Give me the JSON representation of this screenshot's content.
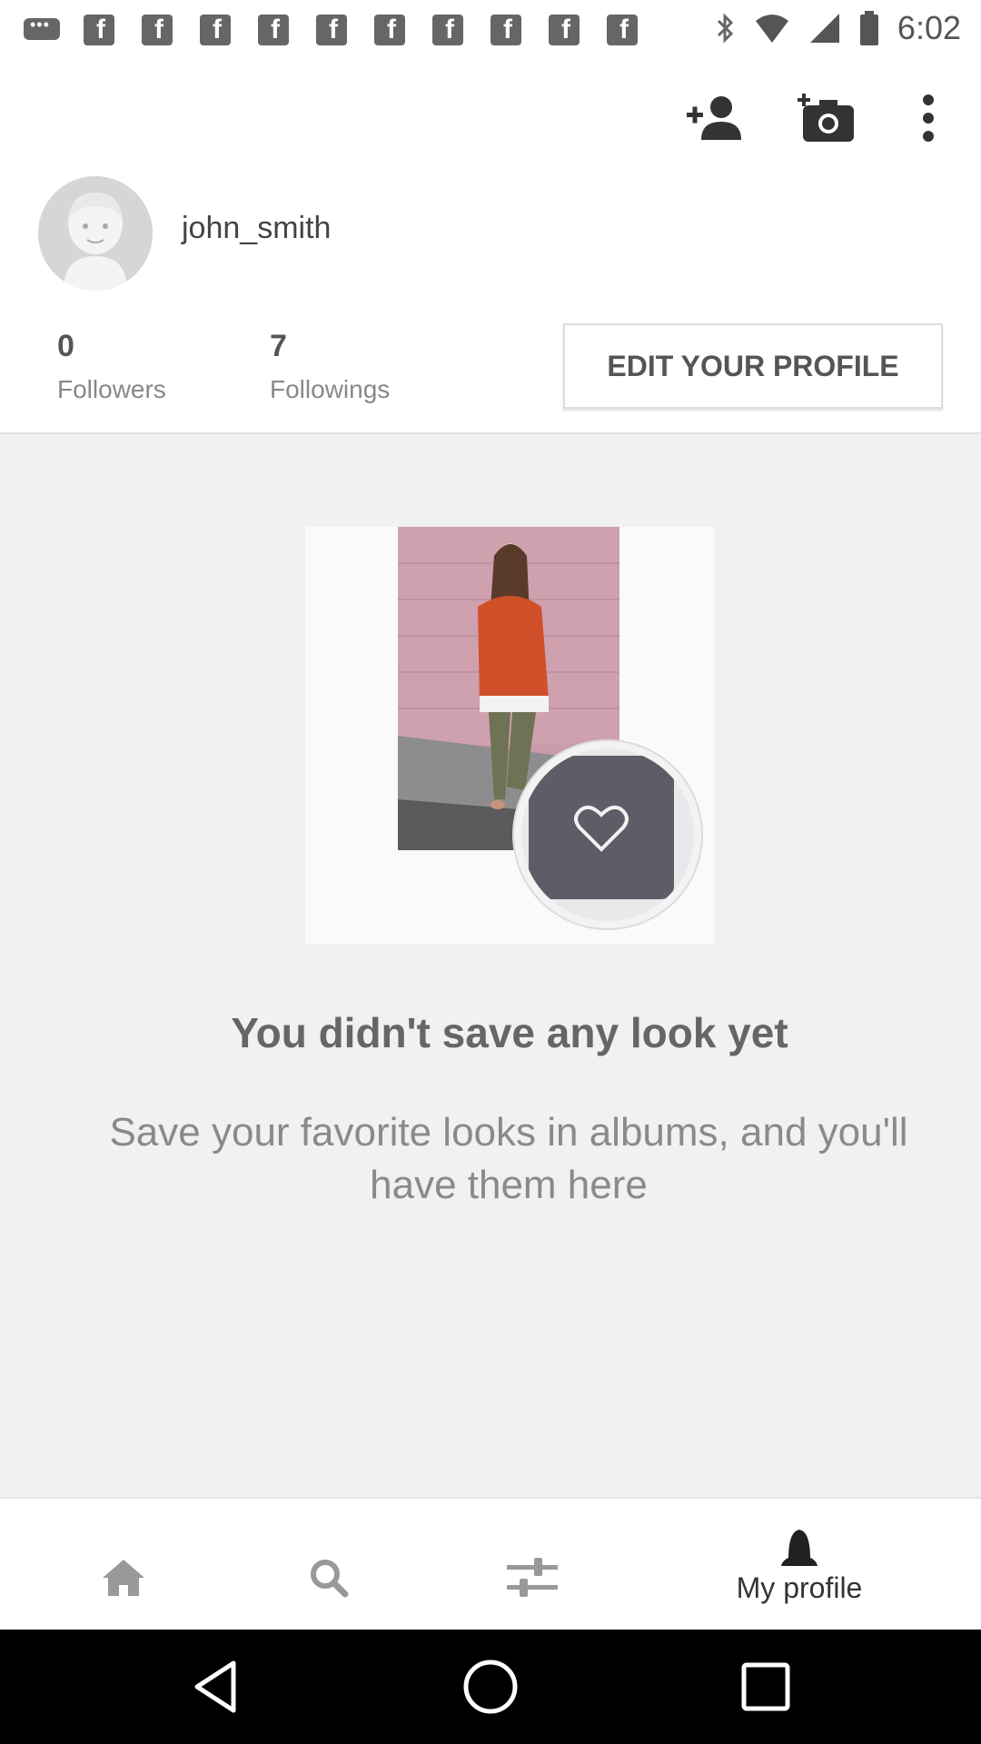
{
  "status_bar": {
    "time": "6:02",
    "notification_icons": [
      "chat-icon",
      "facebook-icon",
      "facebook-icon",
      "facebook-icon",
      "facebook-icon",
      "facebook-icon",
      "facebook-icon",
      "facebook-icon",
      "facebook-icon",
      "facebook-icon",
      "facebook-icon"
    ],
    "system_icons": [
      "bluetooth-icon",
      "wifi-icon",
      "signal-icon",
      "battery-icon"
    ]
  },
  "toolbar": {
    "icons": [
      "add-person-icon",
      "add-photo-icon",
      "more-vert-icon"
    ]
  },
  "profile": {
    "username": "john_smith",
    "followers_count": "0",
    "followers_label": "Followers",
    "followings_count": "7",
    "followings_label": "Followings",
    "edit_button_label": "EDIT YOUR PROFILE"
  },
  "empty_state": {
    "title": "You didn't save any look yet",
    "description": "Save your favorite looks in albums, and you'll have them here"
  },
  "bottom_nav": {
    "items": [
      {
        "icon": "home-icon",
        "label": ""
      },
      {
        "icon": "search-icon",
        "label": ""
      },
      {
        "icon": "filters-icon",
        "label": ""
      },
      {
        "icon": "profile-icon",
        "label": "My profile"
      }
    ]
  },
  "system_nav": {
    "icons": [
      "back-icon",
      "home-circle-icon",
      "recents-icon"
    ]
  },
  "colors": {
    "icon_dark": "#444444",
    "text_muted": "#888888",
    "background_main": "#f1f1f1"
  }
}
